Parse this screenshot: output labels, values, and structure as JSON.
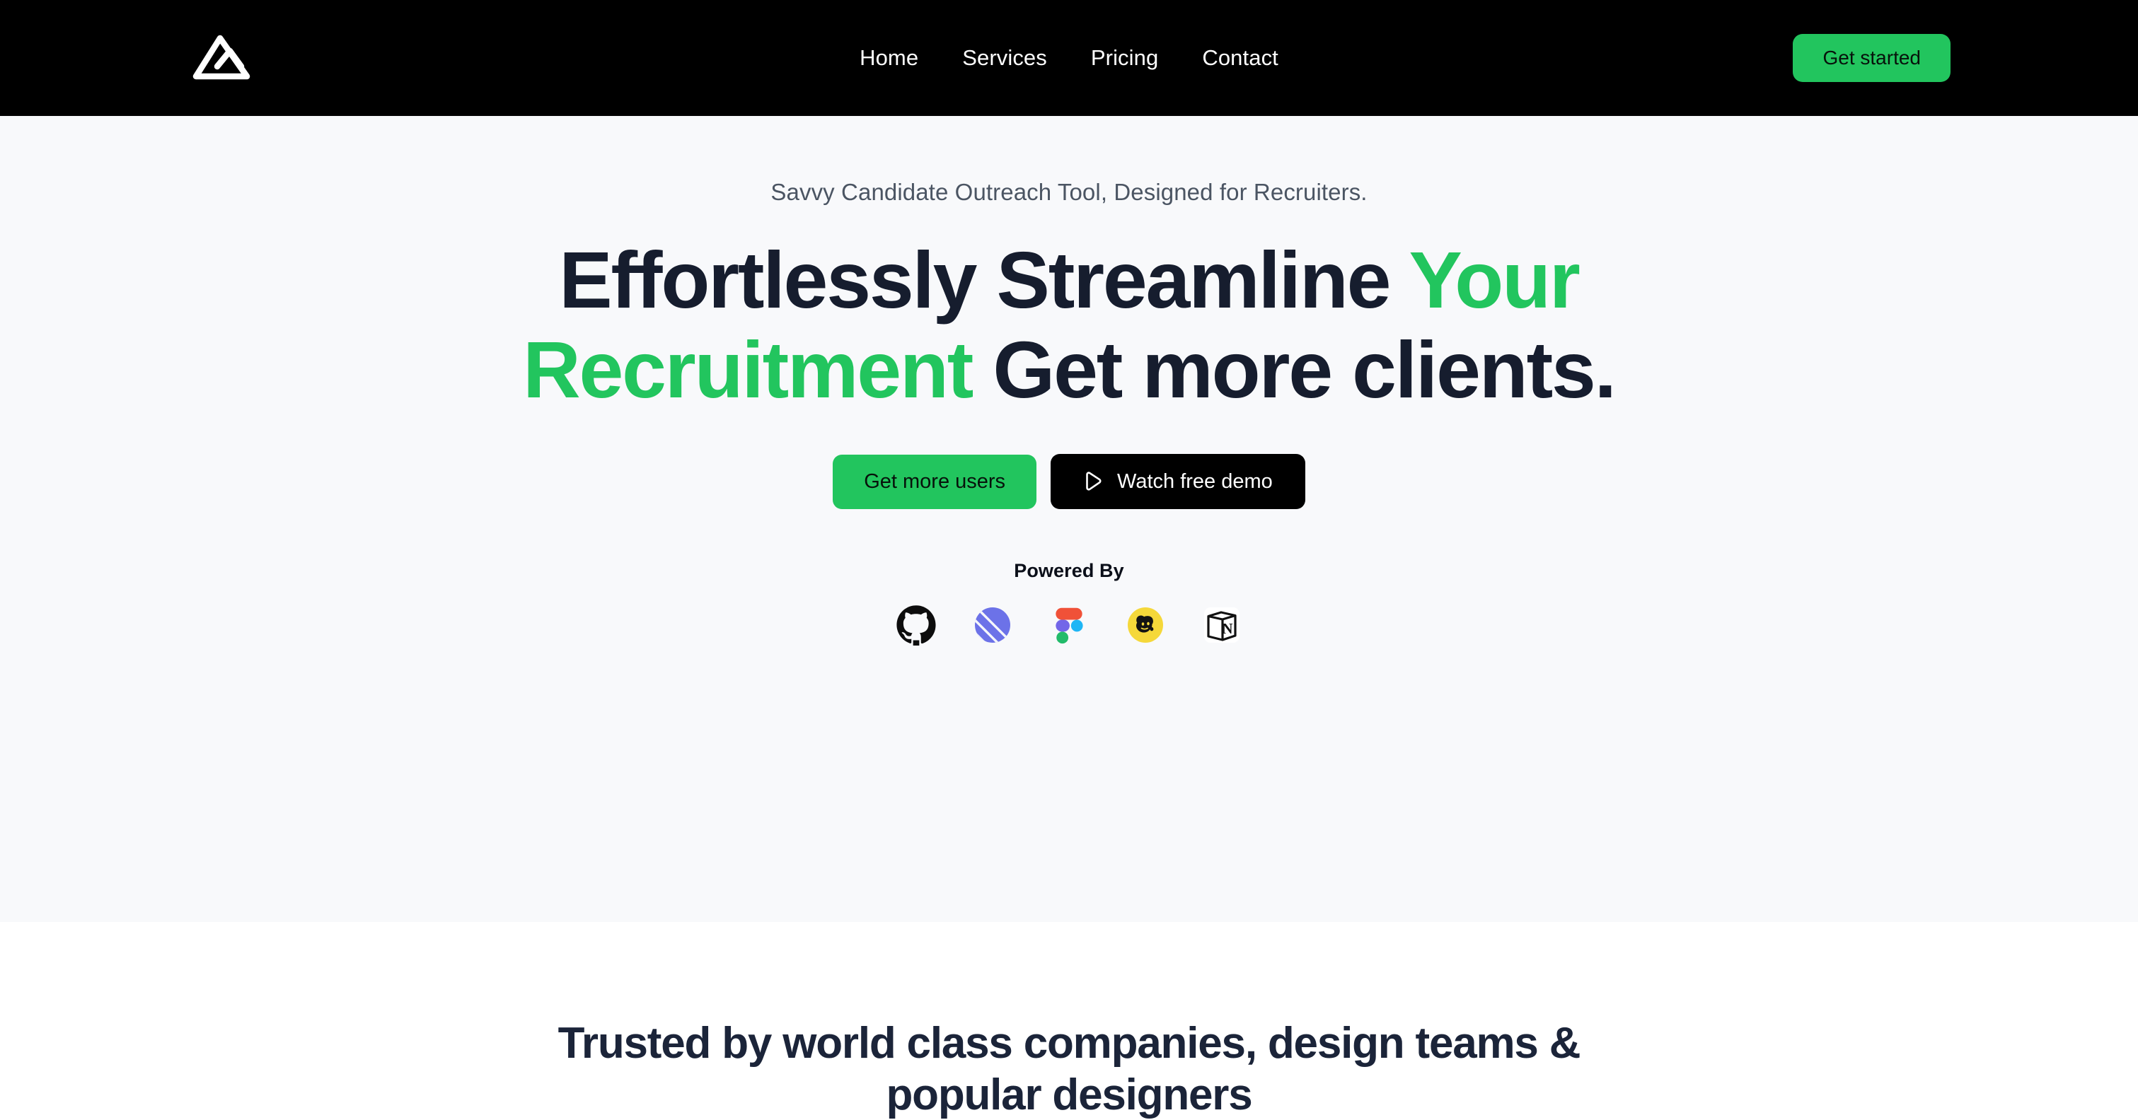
{
  "theme": {
    "accent_green": "#22c55e",
    "header_bg": "#000000",
    "hero_bg": "#f8f9fb",
    "heading_navy": "#161d2e",
    "body_gray": "#4b5563"
  },
  "header": {
    "logo_name": "mountain-logo",
    "nav": [
      {
        "label": "Home"
      },
      {
        "label": "Services"
      },
      {
        "label": "Pricing"
      },
      {
        "label": "Contact"
      }
    ],
    "cta_label": "Get started"
  },
  "hero": {
    "eyebrow": "Savvy Candidate Outreach Tool, Designed for Recruiters.",
    "title_part_1": "Effortlessly Streamline ",
    "title_highlight": "Your Recruitment",
    "title_part_2": " Get more clients.",
    "primary_cta": "Get more users",
    "secondary_cta": "Watch free demo",
    "secondary_cta_icon": "play-icon",
    "powered_by_label": "Powered By",
    "brand_logos": [
      {
        "name": "github-icon",
        "label": "GitHub"
      },
      {
        "name": "linear-icon",
        "label": "Linear"
      },
      {
        "name": "figma-icon",
        "label": "Figma"
      },
      {
        "name": "mailchimp-icon",
        "label": "Mailchimp"
      },
      {
        "name": "notion-icon",
        "label": "Notion"
      }
    ]
  },
  "trusted": {
    "title": "Trusted by world class companies, design teams & popular designers"
  }
}
